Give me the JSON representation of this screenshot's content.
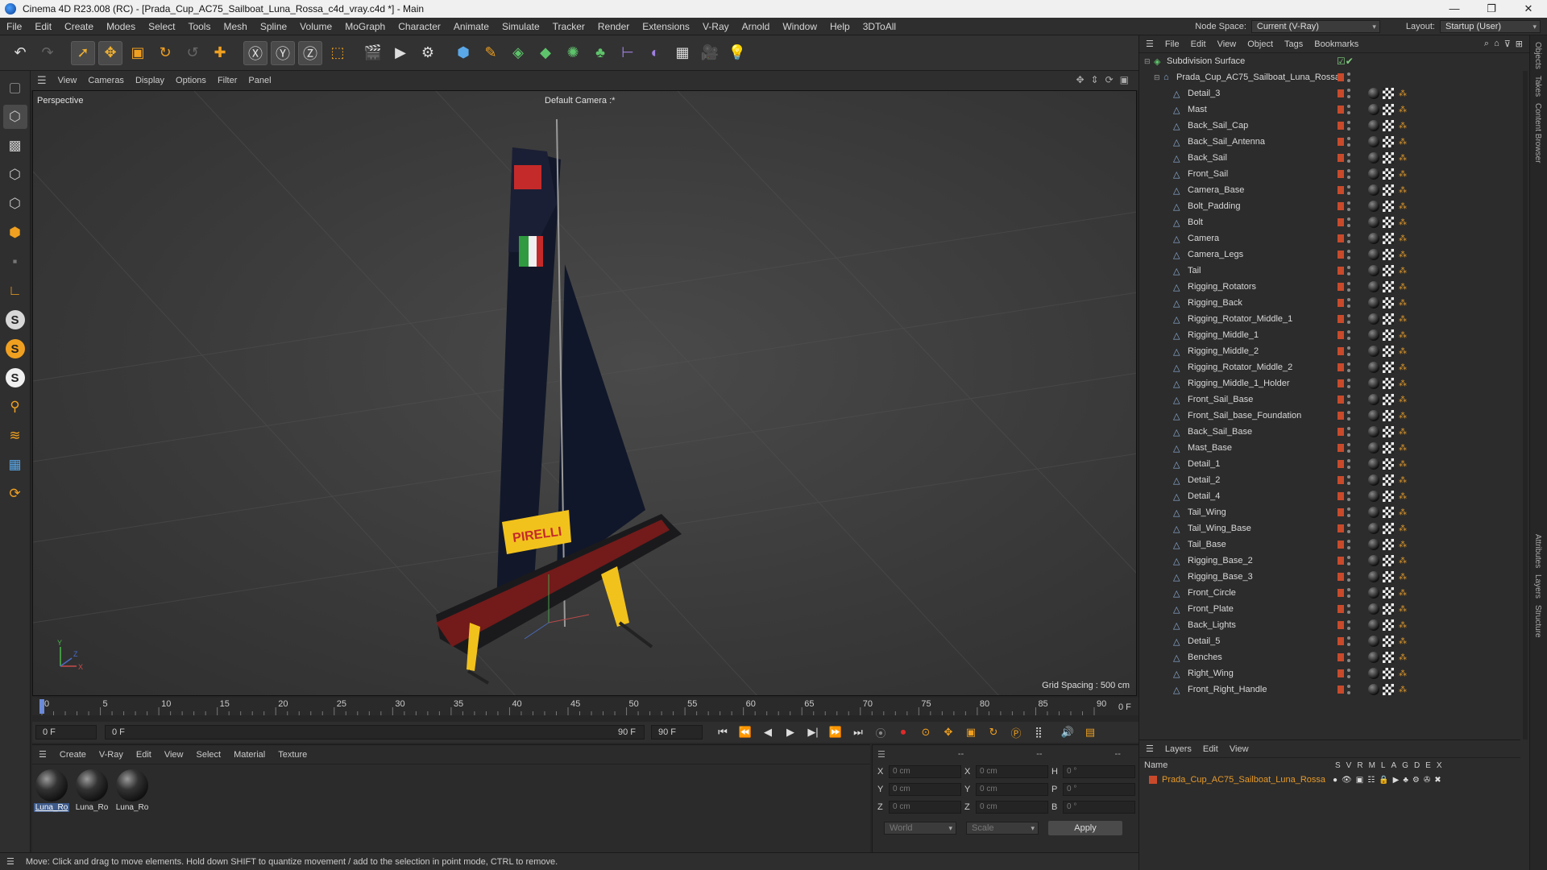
{
  "window": {
    "title": "Cinema 4D R23.008 (RC) - [Prada_Cup_AC75_Sailboat_Luna_Rossa_c4d_vray.c4d *] - Main",
    "controls": [
      "—",
      "❐",
      "✕"
    ]
  },
  "menubar": [
    "File",
    "Edit",
    "Create",
    "Modes",
    "Select",
    "Tools",
    "Mesh",
    "Spline",
    "Volume",
    "MoGraph",
    "Character",
    "Animate",
    "Simulate",
    "Tracker",
    "Render",
    "Extensions",
    "V-Ray",
    "Arnold",
    "Window",
    "Help",
    "3DToAll"
  ],
  "nodespace": {
    "label": "Node Space:",
    "value": "Current (V-Ray)",
    "layout_label": "Layout:",
    "layout_value": "Startup (User)"
  },
  "viewport": {
    "menu": [
      "View",
      "Cameras",
      "Display",
      "Options",
      "Filter",
      "Panel"
    ],
    "label": "Perspective",
    "camera": "Default Camera",
    "camera_mark": ":*",
    "grid_spacing": "Grid Spacing : 500 cm"
  },
  "timeline": {
    "ticks": [
      "0",
      "5",
      "10",
      "15",
      "20",
      "25",
      "30",
      "35",
      "40",
      "45",
      "50",
      "55",
      "60",
      "65",
      "70",
      "75",
      "80",
      "85",
      "90"
    ],
    "end_label": "0 F"
  },
  "transport": {
    "start": "0 F",
    "current": "0 F",
    "range_end": "90 F",
    "end": "90 F"
  },
  "materials": {
    "menu": [
      "Create",
      "V-Ray",
      "Edit",
      "View",
      "Select",
      "Material",
      "Texture"
    ],
    "items": [
      {
        "label": "Luna_Ro"
      },
      {
        "label": "Luna_Ro"
      },
      {
        "label": "Luna_Ro"
      }
    ]
  },
  "coords": {
    "head": [
      "--",
      "--",
      "--"
    ],
    "rows": [
      {
        "a": "X",
        "av": "0 cm",
        "b": "X",
        "bv": "0 cm",
        "c": "H",
        "cv": "0 °"
      },
      {
        "a": "Y",
        "av": "0 cm",
        "b": "Y",
        "bv": "0 cm",
        "c": "P",
        "cv": "0 °"
      },
      {
        "a": "Z",
        "av": "0 cm",
        "b": "Z",
        "bv": "0 cm",
        "c": "B",
        "cv": "0 °"
      }
    ],
    "mode1": "World",
    "mode2": "Scale",
    "apply": "Apply"
  },
  "status": "Move: Click and drag to move elements. Hold down SHIFT to quantize movement / add to the selection in point mode, CTRL to remove.",
  "object_manager": {
    "menu": [
      "File",
      "Edit",
      "View",
      "Object",
      "Tags",
      "Bookmarks"
    ],
    "top": "Subdivision Surface",
    "group": "Prada_Cup_AC75_Sailboat_Luna_Rossa",
    "objects": [
      "Detail_3",
      "Mast",
      "Back_Sail_Cap",
      "Back_Sail_Antenna",
      "Back_Sail",
      "Front_Sail",
      "Camera_Base",
      "Bolt_Padding",
      "Bolt",
      "Camera",
      "Camera_Legs",
      "Tail",
      "Rigging_Rotators",
      "Rigging_Back",
      "Rigging_Rotator_Middle_1",
      "Rigging_Middle_1",
      "Rigging_Middle_2",
      "Rigging_Rotator_Middle_2",
      "Rigging_Middle_1_Holder",
      "Front_Sail_Base",
      "Front_Sail_base_Foundation",
      "Back_Sail_Base",
      "Mast_Base",
      "Detail_1",
      "Detail_2",
      "Detail_4",
      "Tail_Wing",
      "Tail_Wing_Base",
      "Tail_Base",
      "Rigging_Base_2",
      "Rigging_Base_3",
      "Front_Circle",
      "Front_Plate",
      "Back_Lights",
      "Detail_5",
      "Benches",
      "Right_Wing",
      "Front_Right_Handle"
    ]
  },
  "layers": {
    "menu": [
      "Layers",
      "Edit",
      "View"
    ],
    "name_header": "Name",
    "cols": [
      "S",
      "V",
      "R",
      "M",
      "L",
      "A",
      "G",
      "D",
      "E",
      "X"
    ],
    "rows": [
      {
        "name": "Prada_Cup_AC75_Sailboat_Luna_Rossa"
      }
    ]
  },
  "side_tabs": [
    "Objects",
    "Takes",
    "Content Browser",
    "Attributes",
    "Layers",
    "Structure"
  ]
}
